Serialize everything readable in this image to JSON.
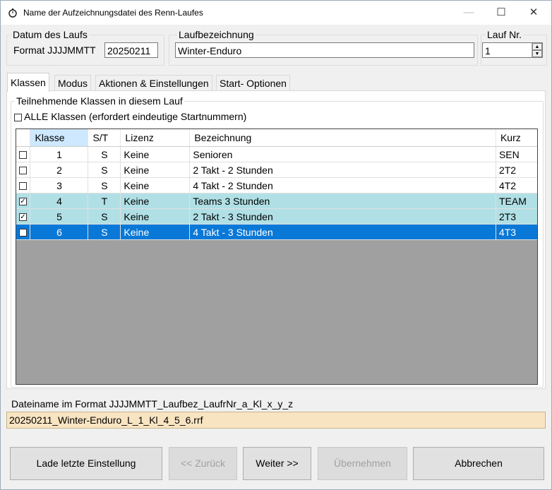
{
  "window": {
    "title": "Name der Aufzeichnungsdatei des Renn-Laufes",
    "min": "—",
    "max": "☐",
    "close": "✕"
  },
  "date_group": {
    "label": "Datum des Laufs",
    "format_label": "Format JJJJMMTT",
    "value": "20250211"
  },
  "name_group": {
    "label": "Laufbezeichnung",
    "value": "Winter-Enduro"
  },
  "run_group": {
    "label": "Lauf Nr.",
    "value": "1"
  },
  "tabs": [
    {
      "label": "Klassen",
      "active": true
    },
    {
      "label": "Modus",
      "active": false
    },
    {
      "label": "Aktionen & Einstellungen",
      "active": false
    },
    {
      "label": "Start- Optionen",
      "active": false
    }
  ],
  "classes_panel": {
    "group_label": "Teilnehmende Klassen in diesem Lauf",
    "all_label": "ALLE Klassen (erfordert eindeutige Startnummern)",
    "all_checked": false,
    "columns": [
      "",
      "Klasse",
      "S/T",
      "Lizenz",
      "Bezeichnung",
      "Kurz"
    ],
    "rows": [
      {
        "checked": false,
        "klasse": "1",
        "st": "S",
        "lizenz": "Keine",
        "bezeichnung": "Senioren",
        "kurz": "SEN",
        "state": "normal"
      },
      {
        "checked": false,
        "klasse": "2",
        "st": "S",
        "lizenz": "Keine",
        "bezeichnung": "2 Takt - 2 Stunden",
        "kurz": "2T2",
        "state": "normal"
      },
      {
        "checked": false,
        "klasse": "3",
        "st": "S",
        "lizenz": "Keine",
        "bezeichnung": "4 Takt - 2 Stunden",
        "kurz": "4T2",
        "state": "normal"
      },
      {
        "checked": true,
        "klasse": "4",
        "st": "T",
        "lizenz": "Keine",
        "bezeichnung": "Teams 3 Stunden",
        "kurz": "TEAM",
        "state": "highlight"
      },
      {
        "checked": true,
        "klasse": "5",
        "st": "S",
        "lizenz": "Keine",
        "bezeichnung": "2 Takt - 3 Stunden",
        "kurz": "2T3",
        "state": "highlight"
      },
      {
        "checked": true,
        "klasse": "6",
        "st": "S",
        "lizenz": "Keine",
        "bezeichnung": "4 Takt - 3 Stunden",
        "kurz": "4T3",
        "state": "selected"
      }
    ]
  },
  "filename": {
    "label": "Dateiname im Format JJJJMMTT_Laufbez_LaufrNr_a_Kl_x_y_z",
    "value": "20250211_Winter-Enduro_L_1_Kl_4_5_6.rrf"
  },
  "buttons": {
    "load": "Lade letzte Einstellung",
    "back": "<< Zurück",
    "next": "Weiter >>",
    "apply": "Übernehmen",
    "cancel": "Abbrechen"
  },
  "colors": {
    "highlight_row": "#b0e0e6",
    "selected_row": "#0a78d7",
    "filename_bg": "#f9e4c2"
  }
}
